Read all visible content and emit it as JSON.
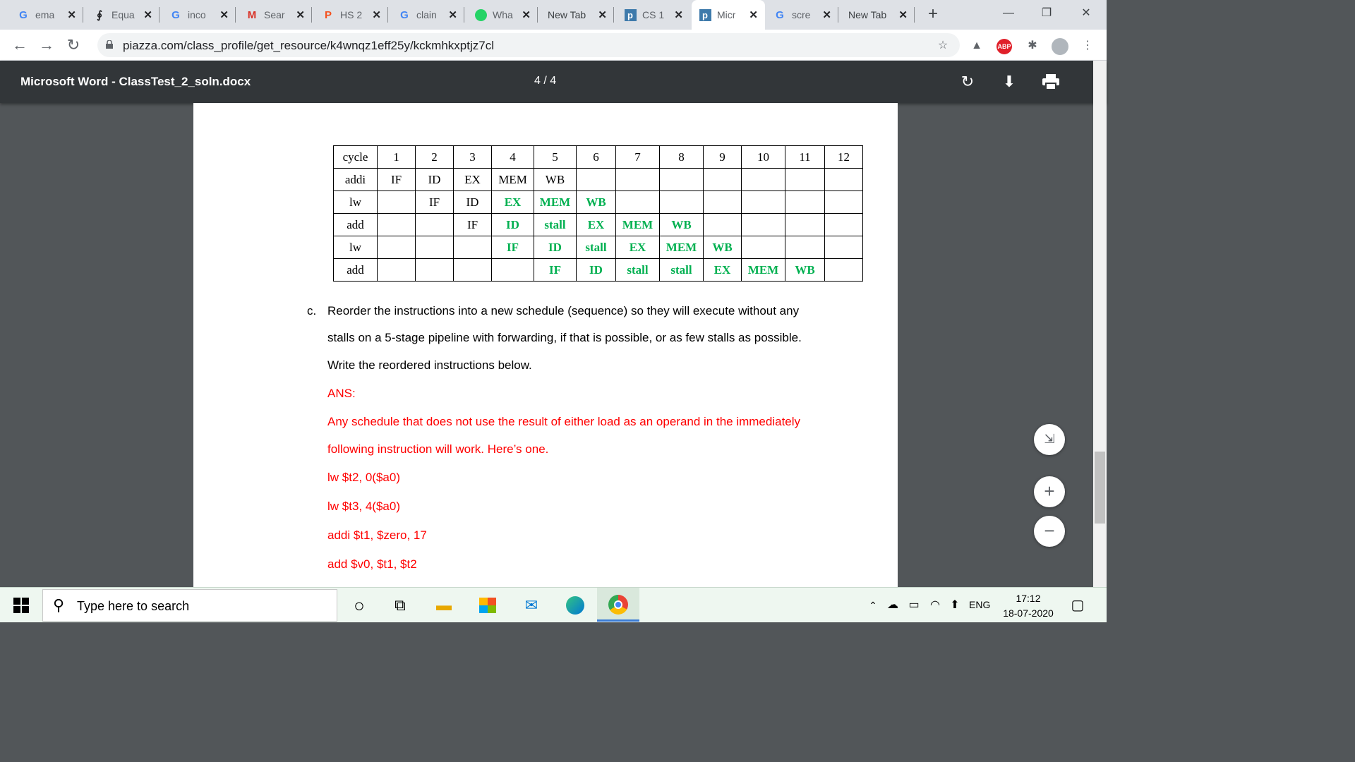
{
  "browser": {
    "tabs": [
      {
        "label": "ema",
        "icon": "google-icon"
      },
      {
        "label": "Equa",
        "icon": "equation-icon"
      },
      {
        "label": "inco",
        "icon": "google-icon"
      },
      {
        "label": "Sear",
        "icon": "gmail-icon"
      },
      {
        "label": "HS 2",
        "icon": "p-icon"
      },
      {
        "label": "clain",
        "icon": "google-icon"
      },
      {
        "label": "Wha",
        "icon": "whatsapp-icon"
      },
      {
        "label": "New Tab",
        "icon": ""
      },
      {
        "label": "CS 1",
        "icon": "piazza-icon"
      },
      {
        "label": "Micr",
        "icon": "piazza-icon"
      },
      {
        "label": "scre",
        "icon": "google-icon"
      },
      {
        "label": "New Tab",
        "icon": ""
      }
    ],
    "url": "piazza.com/class_profile/get_resource/k4wnqz1eff25y/kckmhkxptjz7cl"
  },
  "pdf": {
    "title": "Microsoft Word - ClassTest_2_soln.docx",
    "page_indicator": "4 / 4"
  },
  "pipeline_table": {
    "header": [
      "cycle",
      "1",
      "2",
      "3",
      "4",
      "5",
      "6",
      "7",
      "8",
      "9",
      "10",
      "11",
      "12"
    ],
    "rows": [
      {
        "instr": "addi",
        "cells": [
          "IF",
          "ID",
          "EX",
          "MEM",
          "WB",
          "",
          "",
          "",
          "",
          "",
          "",
          ""
        ],
        "green_from": 99
      },
      {
        "instr": "lw",
        "cells": [
          "",
          "IF",
          "ID",
          "EX",
          "MEM",
          "WB",
          "",
          "",
          "",
          "",
          "",
          ""
        ],
        "green_from": 3
      },
      {
        "instr": "add",
        "cells": [
          "",
          "",
          "IF",
          "ID",
          "stall",
          "EX",
          "MEM",
          "WB",
          "",
          "",
          "",
          ""
        ],
        "green_from": 3
      },
      {
        "instr": "lw",
        "cells": [
          "",
          "",
          "",
          "IF",
          "ID",
          "stall",
          "EX",
          "MEM",
          "WB",
          "",
          "",
          ""
        ],
        "green_from": 3
      },
      {
        "instr": "add",
        "cells": [
          "",
          "",
          "",
          "",
          "IF",
          "ID",
          "stall",
          "stall",
          "EX",
          "MEM",
          "WB",
          ""
        ],
        "green_from": 4
      }
    ]
  },
  "question": {
    "label": "c.",
    "line1": "Reorder the instructions into a new schedule (sequence) so they will execute without any",
    "line2": "stalls on a 5-stage pipeline with forwarding, if that is possible, or as few stalls as possible.",
    "line3": "Write the reordered instructions below."
  },
  "answer": {
    "heading": "ANS:",
    "line1": "Any schedule that does not use the result of either load as an operand in the immediately",
    "line2": "following instruction will work. Here’s one.",
    "instructions": [
      "lw $t2, 0($a0)",
      "lw $t3, 4($a0)",
      "addi $t1, $zero, 17",
      "add $v0, $t1, $t2"
    ]
  },
  "taskbar": {
    "search_placeholder": "Type here to search",
    "language": "ENG",
    "time": "17:12",
    "date": "18-07-2020"
  },
  "colors": {
    "green_text": "#00b050",
    "red_text": "#ff0000",
    "pdf_toolbar": "#323639",
    "viewer_bg": "#525659"
  }
}
